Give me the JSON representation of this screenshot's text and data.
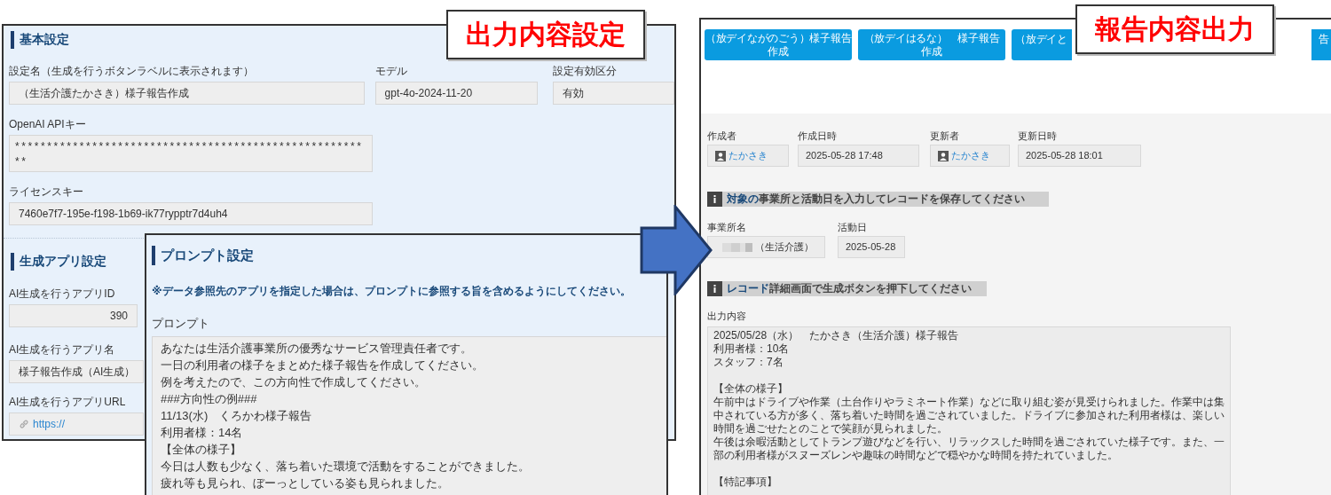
{
  "settings_screen": {
    "callout": "出力内容設定",
    "basic": {
      "heading": "基本設定",
      "name": {
        "label": "設定名（生成を行うボタンラベルに表示されます）",
        "value": "（生活介護たかさき）様子報告作成"
      },
      "model": {
        "label": "モデル",
        "value": "gpt-4o-2024-11-20"
      },
      "status": {
        "label": "設定有効区分",
        "value": "有効"
      },
      "api_key": {
        "label": "OpenAI APIキー",
        "value": "********************************************************"
      },
      "license": {
        "label": "ライセンスキー",
        "value": "7460e7f7-195e-f198-1b69-ik77rypptr7d4uh4"
      }
    },
    "app": {
      "heading": "生成アプリ設定",
      "app_id": {
        "label": "AI生成を行うアプリID",
        "value": "390"
      },
      "app_name": {
        "label": "AI生成を行うアプリ名",
        "value": "様子報告作成（AI生成）"
      },
      "app_url": {
        "label": "AI生成を行うアプリURL",
        "value": "https://"
      }
    }
  },
  "prompt_screen": {
    "heading": "プロンプト設定",
    "note": "※データ参照先のアプリを指定した場合は、プロンプトに参照する旨を含めるようにしてください。",
    "label": "プロンプト",
    "lines": [
      "あなたは生活介護事業所の優秀なサービス管理責任者です。",
      "一日の利用者の様子をまとめた様子報告を作成してください。",
      "例を考えたので、この方向性で作成してください。",
      "###方向性の例###",
      "11/13(水)　くろかわ様子報告",
      "利用者様：14名",
      "【全体の様子】",
      "今日は人数も少なく、落ち着いた環境で活動をすることができました。",
      "疲れ等も見られ、ぼーっとしている姿も見られました。"
    ]
  },
  "report_screen": {
    "callout": "報告内容出力",
    "buttons": [
      {
        "lines": [
          "（放デイながのごう）様子報告",
          "作成"
        ],
        "kind": "full"
      },
      {
        "lines": [
          "（放デイはるな）　様子報告",
          "作成"
        ],
        "kind": "full"
      },
      {
        "lines": [
          "（放デイと"
        ],
        "kind": "head"
      },
      {
        "lines": [
          "告"
        ],
        "kind": "tail"
      }
    ],
    "meta": [
      {
        "label": "作成者",
        "value": "たかさき",
        "kind": "user"
      },
      {
        "label": "作成日時",
        "value": "2025-05-28 17:48",
        "kind": "datetime"
      },
      {
        "label": "更新者",
        "value": "たかさき",
        "kind": "user"
      },
      {
        "label": "更新日時",
        "value": "2025-05-28 18:01",
        "kind": "datetime"
      }
    ],
    "notices": [
      {
        "highlight": "対象の",
        "text": "事業所と活動日を入力してレコードを保存してください"
      },
      {
        "highlight": "レコード",
        "text": "詳細画面で生成ボタンを押下してください"
      }
    ],
    "office": {
      "label": "事業所名",
      "value": "（生活介護）"
    },
    "activity_date": {
      "label": "活動日",
      "value": "2025-05-28"
    },
    "output": {
      "label": "出力内容",
      "blocks": [
        [
          "2025/05/28（水）　たかさき（生活介護）様子報告",
          "利用者様：10名",
          "スタッフ：7名"
        ],
        [
          "【全体の様子】",
          "午前中はドライブや作業（土台作りやラミネート作業）などに取り組む姿が見受けられました。作業中は集中されている方が多く、落ち着いた時間を過ごされていました。ドライブに参加された利用者様は、楽しい時間を過ごせたとのことで笑顔が見られました。",
          "午後は余暇活動としてトランプ遊びなどを行い、リラックスした時間を過ごされていた様子です。また、一部の利用者様がスヌーズレンや趣味の時間などで穏やかな時間を持たれていました。"
        ],
        [
          "【特記事項】"
        ]
      ]
    }
  }
}
